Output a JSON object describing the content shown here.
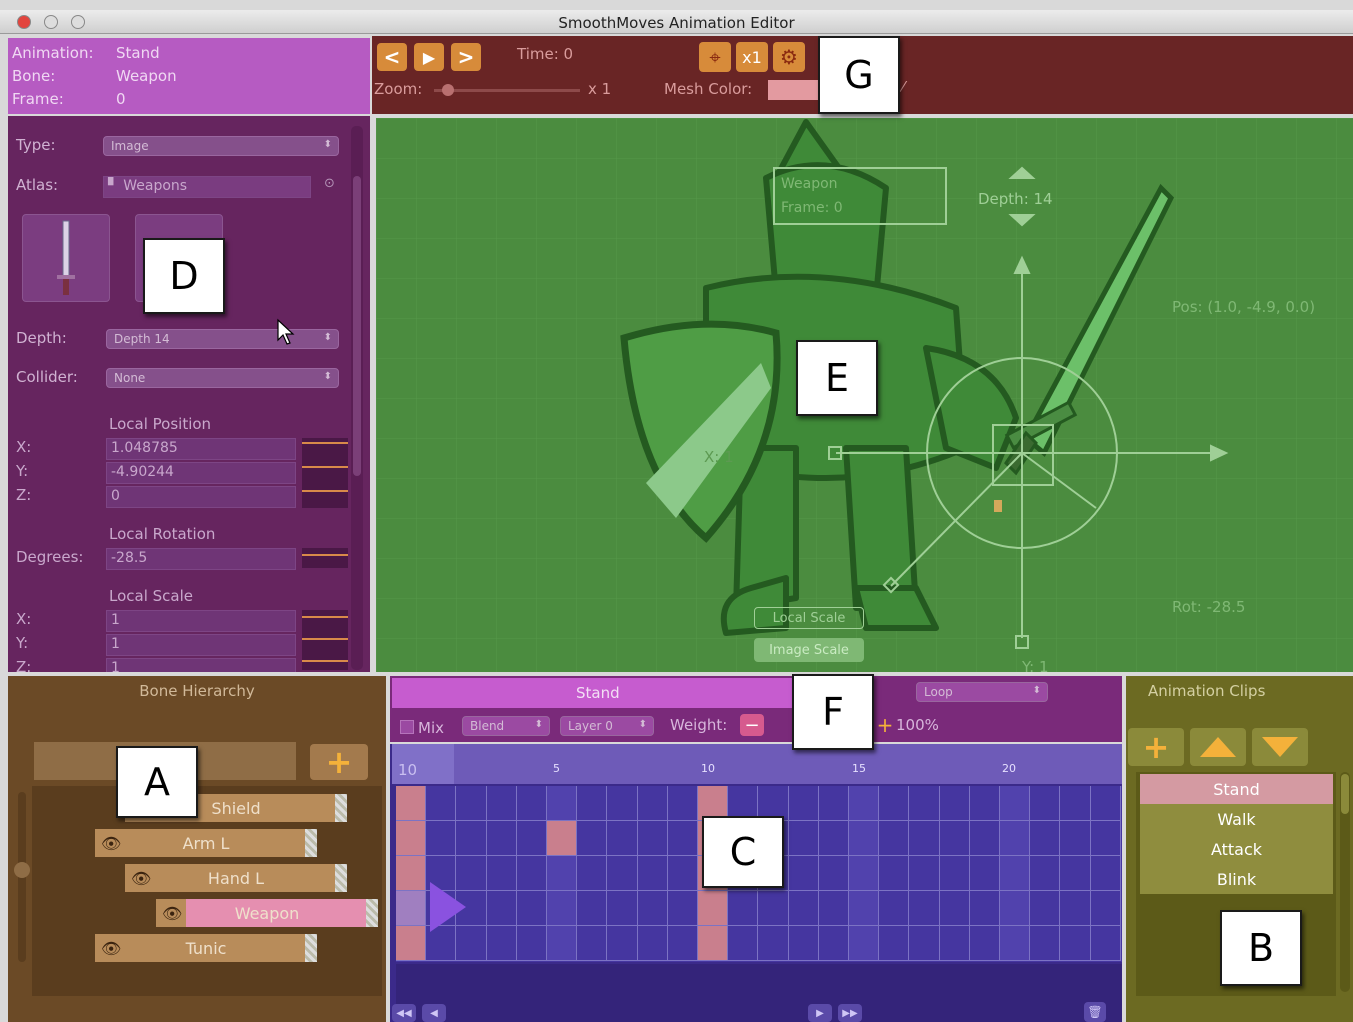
{
  "window": {
    "title": "SmoothMoves Animation Editor"
  },
  "info": {
    "animation_label": "Animation:",
    "animation_value": "Stand",
    "bone_label": "Bone:",
    "bone_value": "Weapon",
    "frame_label": "Frame:",
    "frame_value": "0"
  },
  "inspector": {
    "type_label": "Type:",
    "type_value": "Image",
    "atlas_label": "Atlas:",
    "atlas_value": "Weapons",
    "depth_label": "Depth:",
    "depth_value": "Depth 14",
    "collider_label": "Collider:",
    "collider_value": "None",
    "local_position_heading": "Local Position",
    "x_label": "X:",
    "y_label": "Y:",
    "z_label": "Z:",
    "pos_x": "1.048785",
    "pos_y": "-4.90244",
    "pos_z": "0",
    "local_rotation_heading": "Local Rotation",
    "degrees_label": "Degrees:",
    "degrees_value": "-28.5",
    "local_scale_heading": "Local Scale",
    "scale_x": "1",
    "scale_y": "1",
    "scale_z": "1"
  },
  "toolbar": {
    "prev_glyph": "<",
    "play_glyph": "▶",
    "next_glyph": ">",
    "time_label": "Time: 0",
    "zoom_label": "Zoom:",
    "zoom_value": "x 1",
    "mesh_color_label": "Mesh Color:",
    "mesh_color": "#e39aa0",
    "x1_label": "x1"
  },
  "viewport": {
    "weapon_label": "Weapon",
    "frame_label": "Frame: 0",
    "depth_label": "Depth: 14",
    "pos_label": "Pos: (1.0, -4.9, 0.0)",
    "rot_label": "Rot: -28.5",
    "x_axis_label": "X: 1",
    "y_axis_label": "Y: 1",
    "local_scale_button": "Local Scale",
    "image_scale_button": "Image Scale"
  },
  "bone_hierarchy": {
    "title": "Bone Hierarchy",
    "search_value": "",
    "bones": [
      {
        "name": "Shield"
      },
      {
        "name": "Arm L"
      },
      {
        "name": "Hand L"
      },
      {
        "name": "Weapon"
      },
      {
        "name": "Tunic"
      }
    ]
  },
  "timeline": {
    "animation_name": "Stand",
    "wrap_mode": "Loop",
    "mix_label": "Mix",
    "blend_value": "Blend",
    "layer_value": "Layer 0",
    "weight_label": "Weight:",
    "weight_value": "100%",
    "frame_field": "10",
    "ruler": [
      "5",
      "10",
      "15",
      "20"
    ]
  },
  "clips": {
    "title": "Animation Clips",
    "items": [
      "Stand",
      "Walk",
      "Attack",
      "Blink"
    ]
  },
  "markers": {
    "a": "A",
    "b": "B",
    "c": "C",
    "d": "D",
    "e": "E",
    "f": "F",
    "g": "G"
  },
  "colors": {
    "inspector_bg": "#66255f",
    "info_bg": "#b65bc2",
    "toolbar_bg": "#692525",
    "viewport_bg": "#4b8c3f",
    "hierarchy_bg": "#6b4a26",
    "timeline_bg": "#3b2a8a",
    "clips_bg": "#6c6a22",
    "selected": "#e58fb0"
  },
  "icons": [
    "prev-icon",
    "play-icon",
    "next-icon",
    "crosshair-icon",
    "gear-icon",
    "plus-icon",
    "up-arrow-icon",
    "down-arrow-icon",
    "eye-icon",
    "sword-icon",
    "cursor-icon",
    "keyframe-playhead-icon"
  ]
}
